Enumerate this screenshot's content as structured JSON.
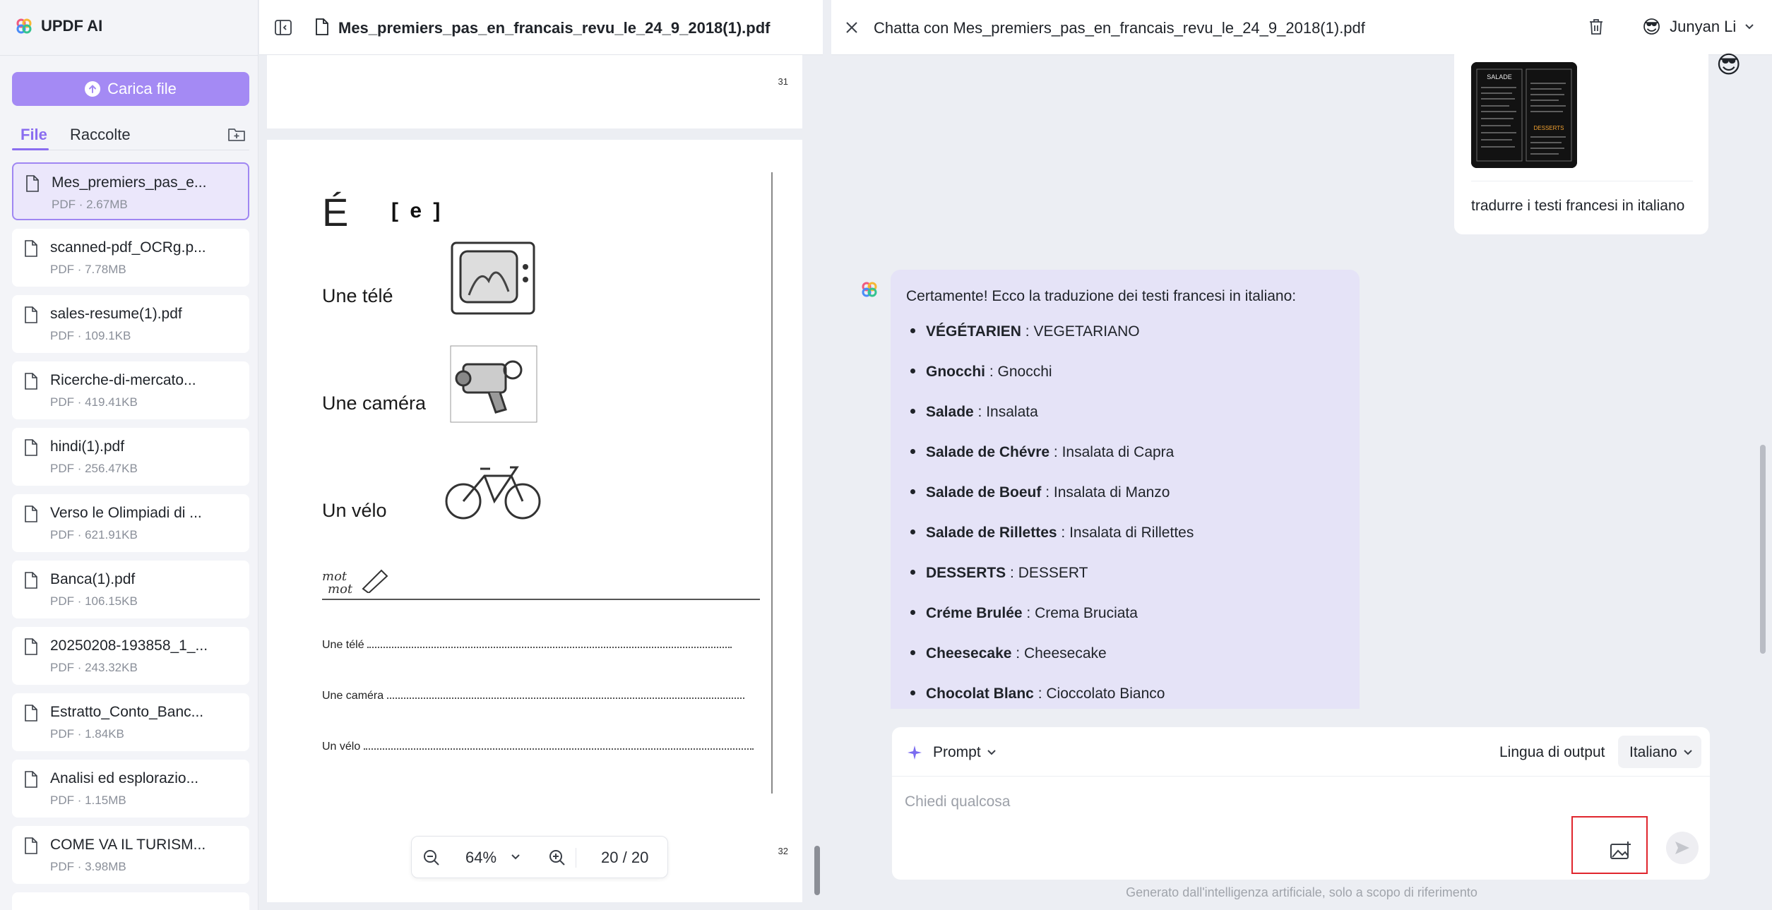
{
  "app": {
    "name": "UPDF AI"
  },
  "sidebar": {
    "upload_label": "Carica file",
    "tabs": [
      "File",
      "Raccolte"
    ],
    "files": [
      {
        "name": "Mes_premiers_pas_e...",
        "meta": "PDF · 2.67MB"
      },
      {
        "name": "scanned-pdf_OCRg.p...",
        "meta": "PDF · 7.78MB"
      },
      {
        "name": "sales-resume(1).pdf",
        "meta": "PDF · 109.1KB"
      },
      {
        "name": "Ricerche-di-mercato...",
        "meta": "PDF · 419.41KB"
      },
      {
        "name": "hindi(1).pdf",
        "meta": "PDF · 256.47KB"
      },
      {
        "name": "Verso le Olimpiadi di ...",
        "meta": "PDF · 621.91KB"
      },
      {
        "name": "Banca(1).pdf",
        "meta": "PDF · 106.15KB"
      },
      {
        "name": "20250208-193858_1_...",
        "meta": "PDF · 243.32KB"
      },
      {
        "name": "Estratto_Conto_Banc...",
        "meta": "PDF · 1.84KB"
      },
      {
        "name": "Analisi ed esplorazio...",
        "meta": "PDF · 1.15MB"
      },
      {
        "name": "COME VA IL TURISM...",
        "meta": "PDF · 3.98MB"
      }
    ]
  },
  "viewer": {
    "title": "Mes_premiers_pas_en_francais_revu_le_24_9_2018(1).pdf",
    "page_top_number": "31",
    "page_bottom_number": "32",
    "page": {
      "letter": "É",
      "phoneme": "[ e ]",
      "words": [
        "Une télé",
        "Une caméra",
        "Un vélo"
      ],
      "motmot": [
        "mot",
        "mot"
      ],
      "fill_rows": [
        "Une télé",
        "Une caméra",
        "Un vélo"
      ]
    },
    "zoom": "64%",
    "page_current": "20",
    "page_sep": "/",
    "page_total": "20"
  },
  "chat": {
    "title": "Chatta con Mes_premiers_pas_en_francais_revu_le_24_9_2018(1).pdf",
    "user_name": "Junyan Li",
    "user_emoji": "😎",
    "user_message": "tradurre i testi francesi in italiano",
    "thumb_labels": [
      "SALADE",
      "DESSERTS"
    ],
    "ai_intro": "Certamente! Ecco la traduzione dei testi francesi in italiano:",
    "ai_items": [
      {
        "fr": "VÉGÉTARIEN",
        "it": " : VEGETARIANO"
      },
      {
        "fr": "Gnocchi",
        "it": " : Gnocchi"
      },
      {
        "fr": "Salade",
        "it": " : Insalata"
      },
      {
        "fr": "Salade de Chévre",
        "it": " : Insalata di Capra"
      },
      {
        "fr": "Salade de Boeuf",
        "it": " : Insalata di Manzo"
      },
      {
        "fr": "Salade de Rillettes",
        "it": " : Insalata di Rillettes"
      },
      {
        "fr": "DESSERTS",
        "it": " : DESSERT"
      },
      {
        "fr": "Créme Brulée",
        "it": " : Crema Bruciata"
      },
      {
        "fr": "Cheesecake",
        "it": " : Cheesecake"
      },
      {
        "fr": "Chocolat Blanc",
        "it": " : Cioccolato Bianco"
      }
    ],
    "prompt_label": "Prompt",
    "output_label": "Lingua di output",
    "output_lang": "Italiano",
    "input_placeholder": "Chiedi qualcosa",
    "footnote": "Generato dall'intelligenza artificiale, solo a scopo di riferimento"
  },
  "colors": {
    "accent": "#a48af4",
    "highlight_border": "#e0262e",
    "ai_bubble": "#e5e3f7"
  }
}
